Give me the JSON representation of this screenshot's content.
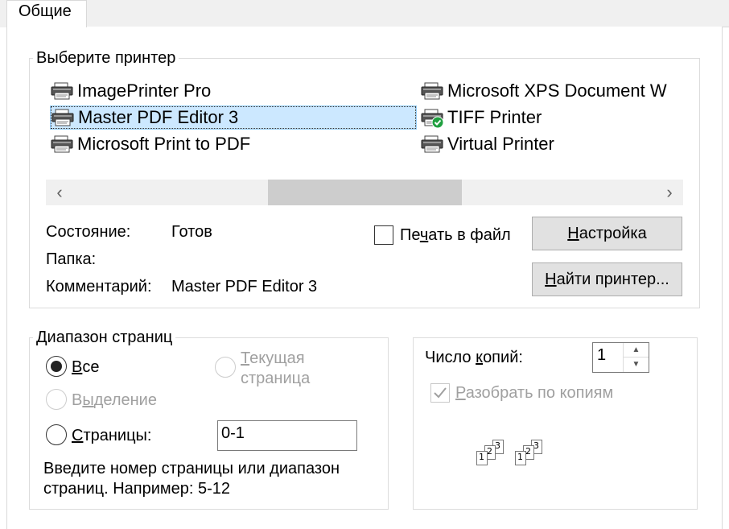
{
  "tabs": [
    {
      "label": "Общие"
    }
  ],
  "printer_group": {
    "legend": "Выберите принтер",
    "printers": [
      {
        "name": "ImagePrinter Pro",
        "column": "left"
      },
      {
        "name": "Master PDF Editor 3",
        "column": "left",
        "selected": true
      },
      {
        "name": "Microsoft Print to PDF",
        "column": "left"
      },
      {
        "name": "Microsoft XPS Document W",
        "column": "right"
      },
      {
        "name": "TIFF Printer",
        "column": "right",
        "default": true
      },
      {
        "name": "Virtual Printer",
        "column": "right"
      }
    ],
    "scroll_left": "‹",
    "scroll_right": "›",
    "status_label": "Состояние:",
    "status_value": "Готов",
    "folder_label": "Папка:",
    "folder_value": "",
    "comment_label": "Комментарий:",
    "comment_value": "Master PDF Editor 3",
    "print_to_file": {
      "pre": "Пе",
      "ul": "ч",
      "post": "ать в файл",
      "checked": false
    },
    "settings_button": {
      "pre": "",
      "ul": "Н",
      "post": "астройка"
    },
    "find_button": {
      "pre": "",
      "ul": "Н",
      "post": "айти принтер..."
    }
  },
  "range_group": {
    "legend": "Диапазон страниц",
    "all": {
      "pre": "",
      "ul": "В",
      "post": "се",
      "checked": true
    },
    "current": {
      "ul": "Т",
      "line1_post": "екущая",
      "line2": "страница",
      "disabled": true
    },
    "selection": {
      "pre": "В",
      "ul": "ы",
      "post": "деление",
      "disabled": true
    },
    "pages": {
      "pre": "",
      "ul": "С",
      "post": "траницы:",
      "value": "0-1"
    },
    "hint_line1": "Введите номер страницы или диапазон",
    "hint_line2": "страниц.  Например: 5-12"
  },
  "copies_group": {
    "copies_label": {
      "pre": "Число ",
      "ul": "к",
      "post": "опий:"
    },
    "copies_value": "1",
    "collate": {
      "pre": "",
      "ul": "Р",
      "post": "азобрать по копиям",
      "checked": true,
      "disabled": true
    },
    "collate_pages": [
      "1",
      "2",
      "3",
      "1",
      "2",
      "3"
    ]
  },
  "colors": {
    "selection_bg": "#cce8ff",
    "selection_border": "#99d1ff",
    "button_bg": "#e1e1e1",
    "default_badge": "#20a040"
  }
}
